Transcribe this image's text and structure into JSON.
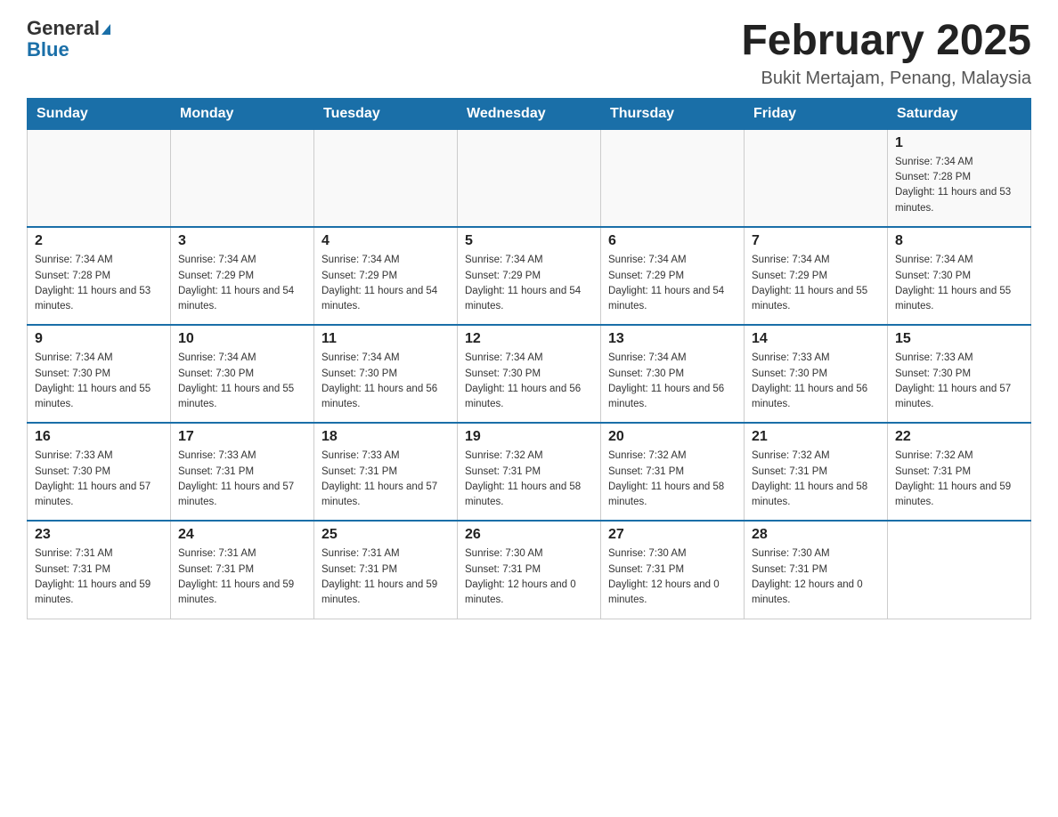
{
  "header": {
    "logo_general": "General",
    "logo_blue": "Blue",
    "title": "February 2025",
    "subtitle": "Bukit Mertajam, Penang, Malaysia"
  },
  "days_of_week": [
    "Sunday",
    "Monday",
    "Tuesday",
    "Wednesday",
    "Thursday",
    "Friday",
    "Saturday"
  ],
  "weeks": [
    {
      "days": [
        {
          "num": "",
          "sunrise": "",
          "sunset": "",
          "daylight": ""
        },
        {
          "num": "",
          "sunrise": "",
          "sunset": "",
          "daylight": ""
        },
        {
          "num": "",
          "sunrise": "",
          "sunset": "",
          "daylight": ""
        },
        {
          "num": "",
          "sunrise": "",
          "sunset": "",
          "daylight": ""
        },
        {
          "num": "",
          "sunrise": "",
          "sunset": "",
          "daylight": ""
        },
        {
          "num": "",
          "sunrise": "",
          "sunset": "",
          "daylight": ""
        },
        {
          "num": "1",
          "sunrise": "Sunrise: 7:34 AM",
          "sunset": "Sunset: 7:28 PM",
          "daylight": "Daylight: 11 hours and 53 minutes."
        }
      ]
    },
    {
      "days": [
        {
          "num": "2",
          "sunrise": "Sunrise: 7:34 AM",
          "sunset": "Sunset: 7:28 PM",
          "daylight": "Daylight: 11 hours and 53 minutes."
        },
        {
          "num": "3",
          "sunrise": "Sunrise: 7:34 AM",
          "sunset": "Sunset: 7:29 PM",
          "daylight": "Daylight: 11 hours and 54 minutes."
        },
        {
          "num": "4",
          "sunrise": "Sunrise: 7:34 AM",
          "sunset": "Sunset: 7:29 PM",
          "daylight": "Daylight: 11 hours and 54 minutes."
        },
        {
          "num": "5",
          "sunrise": "Sunrise: 7:34 AM",
          "sunset": "Sunset: 7:29 PM",
          "daylight": "Daylight: 11 hours and 54 minutes."
        },
        {
          "num": "6",
          "sunrise": "Sunrise: 7:34 AM",
          "sunset": "Sunset: 7:29 PM",
          "daylight": "Daylight: 11 hours and 54 minutes."
        },
        {
          "num": "7",
          "sunrise": "Sunrise: 7:34 AM",
          "sunset": "Sunset: 7:29 PM",
          "daylight": "Daylight: 11 hours and 55 minutes."
        },
        {
          "num": "8",
          "sunrise": "Sunrise: 7:34 AM",
          "sunset": "Sunset: 7:30 PM",
          "daylight": "Daylight: 11 hours and 55 minutes."
        }
      ]
    },
    {
      "days": [
        {
          "num": "9",
          "sunrise": "Sunrise: 7:34 AM",
          "sunset": "Sunset: 7:30 PM",
          "daylight": "Daylight: 11 hours and 55 minutes."
        },
        {
          "num": "10",
          "sunrise": "Sunrise: 7:34 AM",
          "sunset": "Sunset: 7:30 PM",
          "daylight": "Daylight: 11 hours and 55 minutes."
        },
        {
          "num": "11",
          "sunrise": "Sunrise: 7:34 AM",
          "sunset": "Sunset: 7:30 PM",
          "daylight": "Daylight: 11 hours and 56 minutes."
        },
        {
          "num": "12",
          "sunrise": "Sunrise: 7:34 AM",
          "sunset": "Sunset: 7:30 PM",
          "daylight": "Daylight: 11 hours and 56 minutes."
        },
        {
          "num": "13",
          "sunrise": "Sunrise: 7:34 AM",
          "sunset": "Sunset: 7:30 PM",
          "daylight": "Daylight: 11 hours and 56 minutes."
        },
        {
          "num": "14",
          "sunrise": "Sunrise: 7:33 AM",
          "sunset": "Sunset: 7:30 PM",
          "daylight": "Daylight: 11 hours and 56 minutes."
        },
        {
          "num": "15",
          "sunrise": "Sunrise: 7:33 AM",
          "sunset": "Sunset: 7:30 PM",
          "daylight": "Daylight: 11 hours and 57 minutes."
        }
      ]
    },
    {
      "days": [
        {
          "num": "16",
          "sunrise": "Sunrise: 7:33 AM",
          "sunset": "Sunset: 7:30 PM",
          "daylight": "Daylight: 11 hours and 57 minutes."
        },
        {
          "num": "17",
          "sunrise": "Sunrise: 7:33 AM",
          "sunset": "Sunset: 7:31 PM",
          "daylight": "Daylight: 11 hours and 57 minutes."
        },
        {
          "num": "18",
          "sunrise": "Sunrise: 7:33 AM",
          "sunset": "Sunset: 7:31 PM",
          "daylight": "Daylight: 11 hours and 57 minutes."
        },
        {
          "num": "19",
          "sunrise": "Sunrise: 7:32 AM",
          "sunset": "Sunset: 7:31 PM",
          "daylight": "Daylight: 11 hours and 58 minutes."
        },
        {
          "num": "20",
          "sunrise": "Sunrise: 7:32 AM",
          "sunset": "Sunset: 7:31 PM",
          "daylight": "Daylight: 11 hours and 58 minutes."
        },
        {
          "num": "21",
          "sunrise": "Sunrise: 7:32 AM",
          "sunset": "Sunset: 7:31 PM",
          "daylight": "Daylight: 11 hours and 58 minutes."
        },
        {
          "num": "22",
          "sunrise": "Sunrise: 7:32 AM",
          "sunset": "Sunset: 7:31 PM",
          "daylight": "Daylight: 11 hours and 59 minutes."
        }
      ]
    },
    {
      "days": [
        {
          "num": "23",
          "sunrise": "Sunrise: 7:31 AM",
          "sunset": "Sunset: 7:31 PM",
          "daylight": "Daylight: 11 hours and 59 minutes."
        },
        {
          "num": "24",
          "sunrise": "Sunrise: 7:31 AM",
          "sunset": "Sunset: 7:31 PM",
          "daylight": "Daylight: 11 hours and 59 minutes."
        },
        {
          "num": "25",
          "sunrise": "Sunrise: 7:31 AM",
          "sunset": "Sunset: 7:31 PM",
          "daylight": "Daylight: 11 hours and 59 minutes."
        },
        {
          "num": "26",
          "sunrise": "Sunrise: 7:30 AM",
          "sunset": "Sunset: 7:31 PM",
          "daylight": "Daylight: 12 hours and 0 minutes."
        },
        {
          "num": "27",
          "sunrise": "Sunrise: 7:30 AM",
          "sunset": "Sunset: 7:31 PM",
          "daylight": "Daylight: 12 hours and 0 minutes."
        },
        {
          "num": "28",
          "sunrise": "Sunrise: 7:30 AM",
          "sunset": "Sunset: 7:31 PM",
          "daylight": "Daylight: 12 hours and 0 minutes."
        },
        {
          "num": "",
          "sunrise": "",
          "sunset": "",
          "daylight": ""
        }
      ]
    }
  ]
}
